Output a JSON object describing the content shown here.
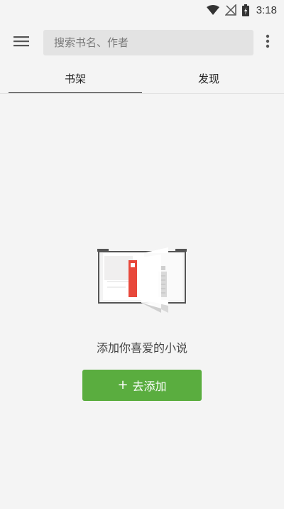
{
  "status_bar": {
    "time": "3:18"
  },
  "toolbar": {
    "search_placeholder": "搜索书名、作者"
  },
  "tabs": [
    {
      "label": "书架",
      "active": true
    },
    {
      "label": "发现",
      "active": false
    }
  ],
  "empty_state": {
    "message": "添加你喜爱的小说",
    "button_label": "去添加",
    "button_icon": "+"
  },
  "colors": {
    "accent_green": "#5aad3f",
    "background": "#f4f4f4",
    "bookmark_red": "#e8483b"
  },
  "icons": {
    "menu": "hamburger-menu-icon",
    "more": "more-vertical-icon",
    "wifi": "wifi-icon",
    "signal": "no-signal-icon",
    "battery": "battery-charging-icon"
  }
}
